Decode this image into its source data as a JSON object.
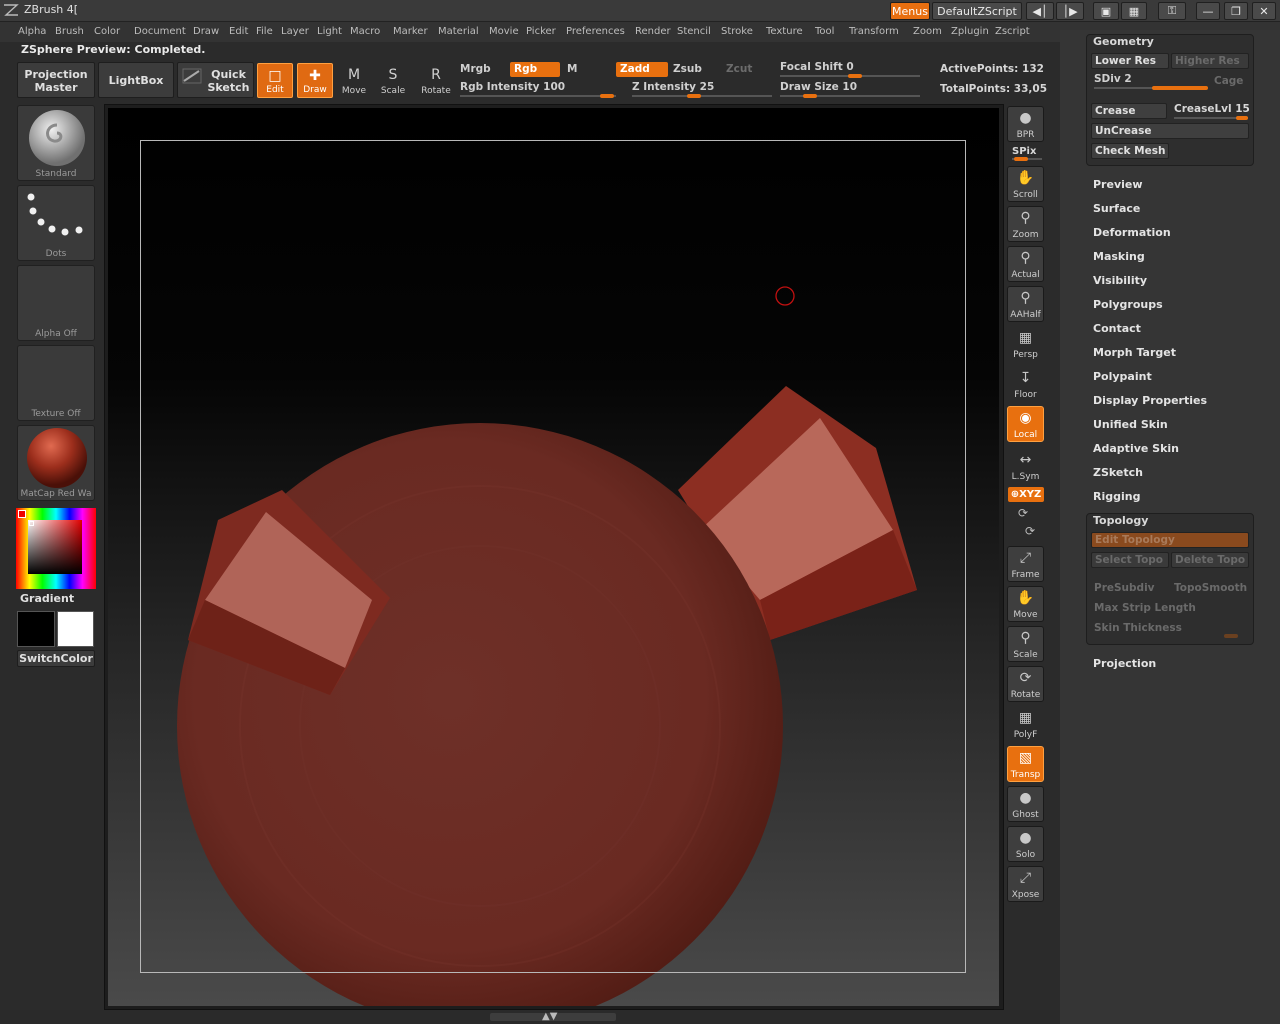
{
  "app": {
    "title": "ZBrush 4["
  },
  "titlebar": {
    "menus_label": "Menus",
    "script_label": "DefaultZScript"
  },
  "menubar": [
    "Alpha",
    "Brush",
    "Color",
    "Document",
    "Draw",
    "Edit",
    "File",
    "Layer",
    "Light",
    "Macro",
    "Marker",
    "Material",
    "Movie",
    "Picker",
    "Preferences",
    "Render",
    "Stencil",
    "Stroke",
    "Texture",
    "Tool",
    "Transform",
    "Zoom",
    "Zplugin",
    "Zscript"
  ],
  "status": {
    "text": "ZSphere Preview: Completed."
  },
  "toolbar": {
    "projection_master": "Projection Master",
    "lightbox": "LightBox",
    "quick_sketch": "Quick Sketch",
    "edit": "Edit",
    "draw": "Draw",
    "move": "Move",
    "scale": "Scale",
    "rotate": "Rotate",
    "mrgb": "Mrgb",
    "rgb": "Rgb",
    "m": "M",
    "zadd": "Zadd",
    "zsub": "Zsub",
    "zcut": "Zcut",
    "rgb_intensity": "Rgb Intensity 100",
    "z_intensity": "Z Intensity 25",
    "focal_shift": "Focal Shift 0",
    "draw_size": "Draw Size 10",
    "active_points": "ActivePoints: 132",
    "total_points": "TotalPoints: 33,05"
  },
  "shelf": {
    "brush": "Standard",
    "stroke": "Dots",
    "alpha": "Alpha  Off",
    "texture": "Texture  Off",
    "material": "MatCap  Red  Wa",
    "gradient": "Gradient",
    "switchcolor": "SwitchColor"
  },
  "right_toolbar": {
    "bpr": "BPR",
    "spix": "SPix",
    "scroll": "Scroll",
    "zoom": "Zoom",
    "actual": "Actual",
    "aahalf": "AAHalf",
    "persp": "Persp",
    "floor": "Floor",
    "local": "Local",
    "lsym": "L.Sym",
    "xyz": "⊕XYZ",
    "frame": "Frame",
    "move": "Move",
    "scale": "Scale",
    "rotate": "Rotate",
    "polyf": "PolyF",
    "transp": "Transp",
    "ghost": "Ghost",
    "solo": "Solo",
    "xpose": "Xpose"
  },
  "geometry": {
    "header": "Geometry",
    "lower_res": "Lower Res",
    "higher_res": "Higher Res",
    "sdiv": "SDiv 2",
    "cage": "Cage",
    "crease": "Crease",
    "crease_lvl": "CreaseLvl 15",
    "uncrease": "UnCrease",
    "check_mesh": "Check Mesh"
  },
  "sections": [
    "Preview",
    "Surface",
    "Deformation",
    "Masking",
    "Visibility",
    "Polygroups",
    "Contact",
    "Morph Target",
    "Polypaint",
    "Display Properties",
    "Unified Skin",
    "Adaptive Skin",
    "ZSketch",
    "Rigging"
  ],
  "topology": {
    "header": "Topology",
    "edit_topology": "Edit Topology",
    "select_topo": "Select Topo",
    "delete_topo": "Delete Topo",
    "presubdiv": "PreSubdiv",
    "toposmooth": "TopoSmooth",
    "max_strip": "Max Strip Length",
    "skin_thickness": "Skin Thickness"
  },
  "projection": "Projection",
  "colors": {
    "accent": "#e8700f",
    "model": "#7a2c22"
  }
}
